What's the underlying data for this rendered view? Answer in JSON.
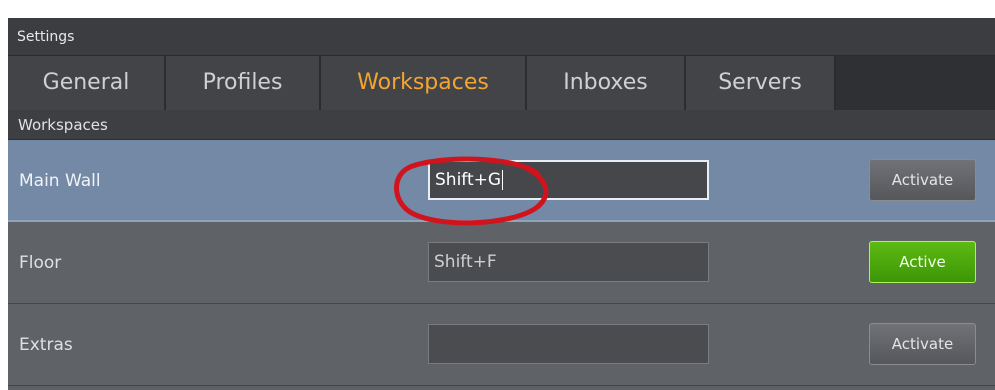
{
  "window": {
    "title": "Settings"
  },
  "tabs": [
    {
      "label": "General",
      "active": false
    },
    {
      "label": "Profiles",
      "active": false
    },
    {
      "label": "Workspaces",
      "active": true
    },
    {
      "label": "Inboxes",
      "active": false
    },
    {
      "label": "Servers",
      "active": false
    }
  ],
  "section": {
    "title": "Workspaces"
  },
  "workspaces": [
    {
      "name": "Main Wall",
      "hotkey": "Shift+G",
      "button": "Activate",
      "selected": true,
      "active": false
    },
    {
      "name": "Floor",
      "hotkey": "Shift+F",
      "button": "Active",
      "selected": false,
      "active": true
    },
    {
      "name": "Extras",
      "hotkey": "",
      "button": "Activate",
      "selected": false,
      "active": false
    }
  ],
  "colors": {
    "active_tab_text": "#f4a531",
    "selected_row": "#7389a5",
    "active_button": "#4aa80b",
    "annotation_circle": "#d0131c"
  }
}
